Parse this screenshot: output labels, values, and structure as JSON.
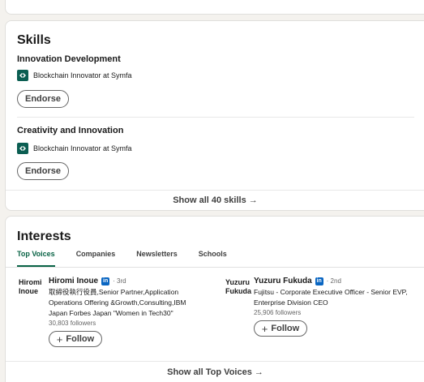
{
  "skills": {
    "title": "Skills",
    "items": [
      {
        "name": "Innovation Development",
        "source_text": "Blockchain Innovator at Symfa",
        "source_icon": "company-logo-icon",
        "endorse_label": "Endorse"
      },
      {
        "name": "Creativity and Innovation",
        "source_text": "Blockchain Innovator at Symfa",
        "source_icon": "company-logo-icon",
        "endorse_label": "Endorse"
      }
    ],
    "show_all_label": "Show all 40 skills →"
  },
  "interests": {
    "title": "Interests",
    "tabs": [
      {
        "label": "Top Voices",
        "active": true
      },
      {
        "label": "Companies",
        "active": false
      },
      {
        "label": "Newsletters",
        "active": false
      },
      {
        "label": "Schools",
        "active": false
      }
    ],
    "voices": [
      {
        "avatar_text": "Hiromi Inoue",
        "name": "Hiromi Inoue",
        "badge": "in",
        "degree": "· 3rd",
        "headline": "取締役執行役員,Senior Partner,Application Operations Offering &Growth,Consulting,IBM Japan Forbes Japan \"Women in Tech30\"",
        "followers": "30,803 followers",
        "follow_label": "Follow"
      },
      {
        "avatar_text": "Yuzuru Fukuda",
        "name": "Yuzuru Fukuda",
        "badge": "in",
        "degree": "· 2nd",
        "headline": "Fujitsu - Corporate Executive Officer - Senior EVP, Enterprise Division CEO",
        "followers": "25,906 followers",
        "follow_label": "Follow"
      }
    ],
    "show_all_label": "Show all Top Voices →"
  },
  "colors": {
    "accent_green": "#0a6446",
    "linkedin_blue": "#0a66c2",
    "company_logo": "#0b5e52"
  }
}
